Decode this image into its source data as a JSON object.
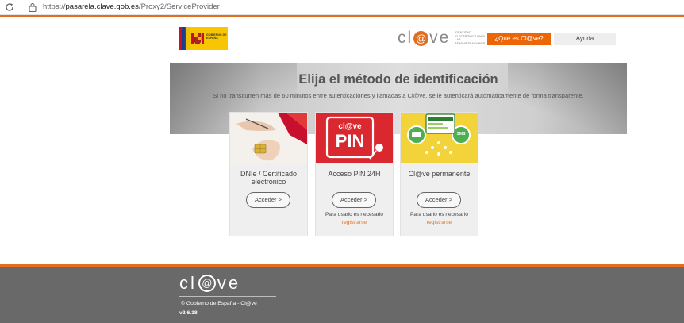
{
  "browser": {
    "url_prefix": "https://",
    "url_domain": "pasarela.clave.gob.es",
    "url_path": "/Proxy2/ServiceProvider"
  },
  "header": {
    "gov_logo_text": "GOBIERNO DE ESPAÑA",
    "clave_logo_parts": [
      "cl",
      "@",
      "ve"
    ],
    "clave_tagline": "IDENTIDAD ELECTRÓNICA PARA LAS ADMINISTRACIONES",
    "what_is_label": "¿Qué es Cl@ve?",
    "help_label": "Ayuda"
  },
  "banner": {
    "title": "Elija el método de identificación",
    "subtitle": "Si no transcurren más de 60 minutos entre autenticaciones y llamadas a Cl@ve, se le autenticará automáticamente de forma transparente."
  },
  "cards": [
    {
      "label": "DNIe / Certificado electrónico",
      "button": "Acceder  >",
      "note": "",
      "register": ""
    },
    {
      "label": "Acceso PIN 24H",
      "button": "Acceder  >",
      "note": "Para usarlo es necesario",
      "register": "registrarse",
      "image_text_top": "cl@ve",
      "image_text_bottom": "PIN"
    },
    {
      "label": "Cl@ve permanente",
      "button": "Acceder  >",
      "note": "Para usarlo es necesario",
      "register": "registrarse",
      "image_text": "SMS"
    }
  ],
  "footer": {
    "logo_parts": [
      "cl",
      "@",
      "ve"
    ],
    "copyright": "© Gobierno de España - Cl@ve",
    "version": "v2.6.18"
  },
  "colors": {
    "accent": "#e36f1e",
    "button_orange": "#ec6608",
    "footer_bg": "#696969"
  }
}
